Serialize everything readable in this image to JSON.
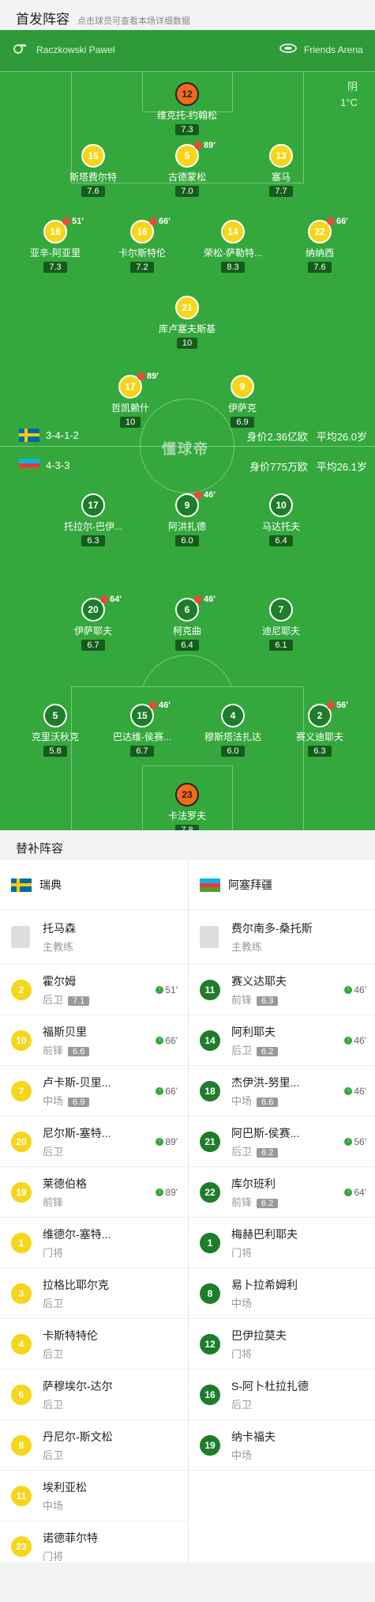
{
  "header": {
    "title": "首发阵容",
    "subtitle": "点击球员可查看本场详细数据"
  },
  "match": {
    "referee": "Raczkowski Paweł",
    "stadium": "Friends Arena",
    "weather": "阴",
    "temp": "1°C",
    "watermark": "懂球帝"
  },
  "home": {
    "formation": "3-4-1-2",
    "value": "身价2.36亿欧",
    "age": "平均26.0岁",
    "flag_colors": [
      "#006aa7",
      "#fecc00"
    ]
  },
  "away": {
    "formation": "4-3-3",
    "value": "身价775万欧",
    "age": "平均26.1岁",
    "flag_colors": [
      "#00b5e2",
      "#ef3340",
      "#509e2f"
    ]
  },
  "home_players": [
    {
      "num": "12",
      "name": "维克托-约翰松",
      "rating": "7.3",
      "color": "orange"
    },
    {
      "num": "15",
      "name": "斯塔费尔特",
      "rating": "7.6",
      "color": "yellow"
    },
    {
      "num": "5",
      "name": "古德蒙松",
      "rating": "7.0",
      "color": "yellow",
      "event": "89'"
    },
    {
      "num": "13",
      "name": "塞马",
      "rating": "7.7",
      "color": "yellow"
    },
    {
      "num": "18",
      "name": "亚辛-阿亚里",
      "rating": "7.3",
      "color": "yellow",
      "event": "51'"
    },
    {
      "num": "16",
      "name": "卡尔斯特伦",
      "rating": "7.2",
      "color": "yellow",
      "event": "66'"
    },
    {
      "num": "14",
      "name": "荣松-萨勒特...",
      "rating": "8.3",
      "color": "yellow"
    },
    {
      "num": "22",
      "name": "纳纳西",
      "rating": "7.6",
      "color": "yellow",
      "event": "66'"
    },
    {
      "num": "21",
      "name": "库卢塞夫斯基",
      "rating": "10",
      "color": "yellow"
    },
    {
      "num": "17",
      "name": "哲凯赖什",
      "rating": "10",
      "color": "yellow",
      "event": "89'"
    },
    {
      "num": "9",
      "name": "伊萨克",
      "rating": "6.9",
      "color": "yellow"
    }
  ],
  "away_players": [
    {
      "num": "17",
      "name": "托拉尔-巴伊...",
      "rating": "6.3"
    },
    {
      "num": "9",
      "name": "阿洪扎德",
      "rating": "6.0",
      "event": "46'"
    },
    {
      "num": "10",
      "name": "马达托夫",
      "rating": "6.4"
    },
    {
      "num": "20",
      "name": "伊萨耶夫",
      "rating": "6.7",
      "event": "64'"
    },
    {
      "num": "6",
      "name": "柯克曲",
      "rating": "6.4",
      "event": "46'"
    },
    {
      "num": "7",
      "name": "迪尼耶夫",
      "rating": "6.1"
    },
    {
      "num": "5",
      "name": "克里沃秋克",
      "rating": "5.8"
    },
    {
      "num": "15",
      "name": "巴达维-侯赛...",
      "rating": "6.7",
      "event": "46'"
    },
    {
      "num": "4",
      "name": "穆斯塔法扎达",
      "rating": "6.0"
    },
    {
      "num": "2",
      "name": "赛义迪耶夫",
      "rating": "6.3",
      "event": "56'"
    },
    {
      "num": "23",
      "name": "卡法罗夫",
      "rating": "7.8"
    }
  ],
  "subs": {
    "title": "替补阵容",
    "home_team": "瑞典",
    "away_team": "阿塞拜疆",
    "home_coach": {
      "name": "托马森",
      "role": "主教练"
    },
    "away_coach": {
      "name": "费尔南多-桑托斯",
      "role": "主教练"
    },
    "home": [
      {
        "num": "2",
        "name": "霍尔姆",
        "pos": "后卫",
        "rating": "7.1",
        "min": "51'"
      },
      {
        "num": "10",
        "name": "福斯贝里",
        "pos": "前锋",
        "rating": "6.6",
        "min": "66'"
      },
      {
        "num": "7",
        "name": "卢卡斯-贝里...",
        "pos": "中场",
        "rating": "6.9",
        "min": "66'"
      },
      {
        "num": "20",
        "name": "尼尔斯-塞特...",
        "pos": "后卫",
        "rating": "",
        "min": "89'"
      },
      {
        "num": "19",
        "name": "莱德伯格",
        "pos": "前锋",
        "rating": "",
        "min": "89'"
      },
      {
        "num": "1",
        "name": "维德尔-塞特...",
        "pos": "门将",
        "rating": "",
        "min": ""
      },
      {
        "num": "3",
        "name": "拉格比耶尔克",
        "pos": "后卫",
        "rating": "",
        "min": ""
      },
      {
        "num": "4",
        "name": "卡斯特特伦",
        "pos": "后卫",
        "rating": "",
        "min": ""
      },
      {
        "num": "6",
        "name": "萨穆埃尔-达尔",
        "pos": "后卫",
        "rating": "",
        "min": ""
      },
      {
        "num": "8",
        "name": "丹尼尔-斯文松",
        "pos": "后卫",
        "rating": "",
        "min": ""
      },
      {
        "num": "11",
        "name": "埃利亚松",
        "pos": "中场",
        "rating": "",
        "min": ""
      },
      {
        "num": "23",
        "name": "诺德菲尔特",
        "pos": "门将",
        "rating": "",
        "min": ""
      }
    ],
    "away": [
      {
        "num": "11",
        "name": "赛义达耶夫",
        "pos": "前锋",
        "rating": "6.3",
        "min": "46'"
      },
      {
        "num": "14",
        "name": "阿利耶夫",
        "pos": "后卫",
        "rating": "6.2",
        "min": "46'"
      },
      {
        "num": "18",
        "name": "杰伊洪-努里...",
        "pos": "中场",
        "rating": "6.6",
        "min": "46'"
      },
      {
        "num": "21",
        "name": "阿巴斯-侯赛...",
        "pos": "后卫",
        "rating": "6.2",
        "min": "56'"
      },
      {
        "num": "22",
        "name": "库尔班利",
        "pos": "前锋",
        "rating": "6.2",
        "min": "64'"
      },
      {
        "num": "1",
        "name": "梅赫巴利耶夫",
        "pos": "门将",
        "rating": "",
        "min": ""
      },
      {
        "num": "8",
        "name": "易卜拉希姆利",
        "pos": "中场",
        "rating": "",
        "min": ""
      },
      {
        "num": "12",
        "name": "巴伊拉莫夫",
        "pos": "门将",
        "rating": "",
        "min": ""
      },
      {
        "num": "16",
        "name": "S-阿卜杜拉扎德",
        "pos": "后卫",
        "rating": "",
        "min": ""
      },
      {
        "num": "19",
        "name": "纳卡福夫",
        "pos": "中场",
        "rating": "",
        "min": ""
      }
    ]
  }
}
